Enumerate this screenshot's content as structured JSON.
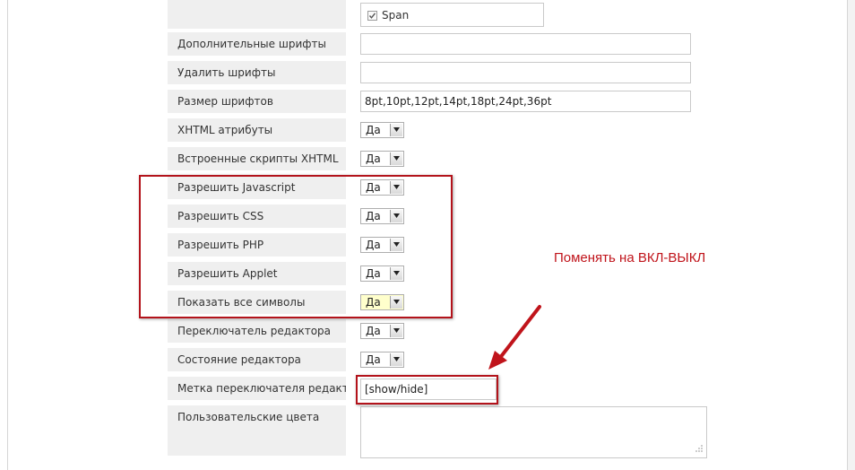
{
  "span_option": {
    "label": "Span",
    "checked": true
  },
  "rows": [
    {
      "label": "Дополнительные шрифты",
      "value": ""
    },
    {
      "label": "Удалить шрифты",
      "value": ""
    },
    {
      "label": "Размер шрифтов",
      "value": "8pt,10pt,12pt,14pt,18pt,24pt,36pt"
    },
    {
      "label": "XHTML атрибуты",
      "value": "Да"
    },
    {
      "label": "Встроенные скрипты XHTML",
      "value": "Да"
    },
    {
      "label": "Разрешить Javascript",
      "value": "Да"
    },
    {
      "label": "Разрешить CSS",
      "value": "Да"
    },
    {
      "label": "Разрешить PHP",
      "value": "Да"
    },
    {
      "label": "Разрешить Applet",
      "value": "Да"
    },
    {
      "label": "Показать все символы",
      "value": "Да"
    },
    {
      "label": "Переключатель редактора",
      "value": "Да"
    },
    {
      "label": "Состояние редактора",
      "value": "Да"
    },
    {
      "label": "Метка переключателя редактора",
      "value": "[show/hide]"
    },
    {
      "label": "Пользовательские цвета",
      "value": ""
    }
  ],
  "annotation": {
    "text": "Поменять на ВКЛ-ВЫКЛ",
    "color": "#c0141b"
  },
  "colors": {
    "label_bg": "#efefef",
    "highlight_select_bg": "#ffffcc",
    "frame_red": "#b3131b"
  },
  "icons": {
    "dropdown": "chevron-down-icon",
    "checkbox": "checkbox-checked-icon",
    "resize": "resize-grip-icon",
    "arrow": "annotation-arrow-icon"
  }
}
